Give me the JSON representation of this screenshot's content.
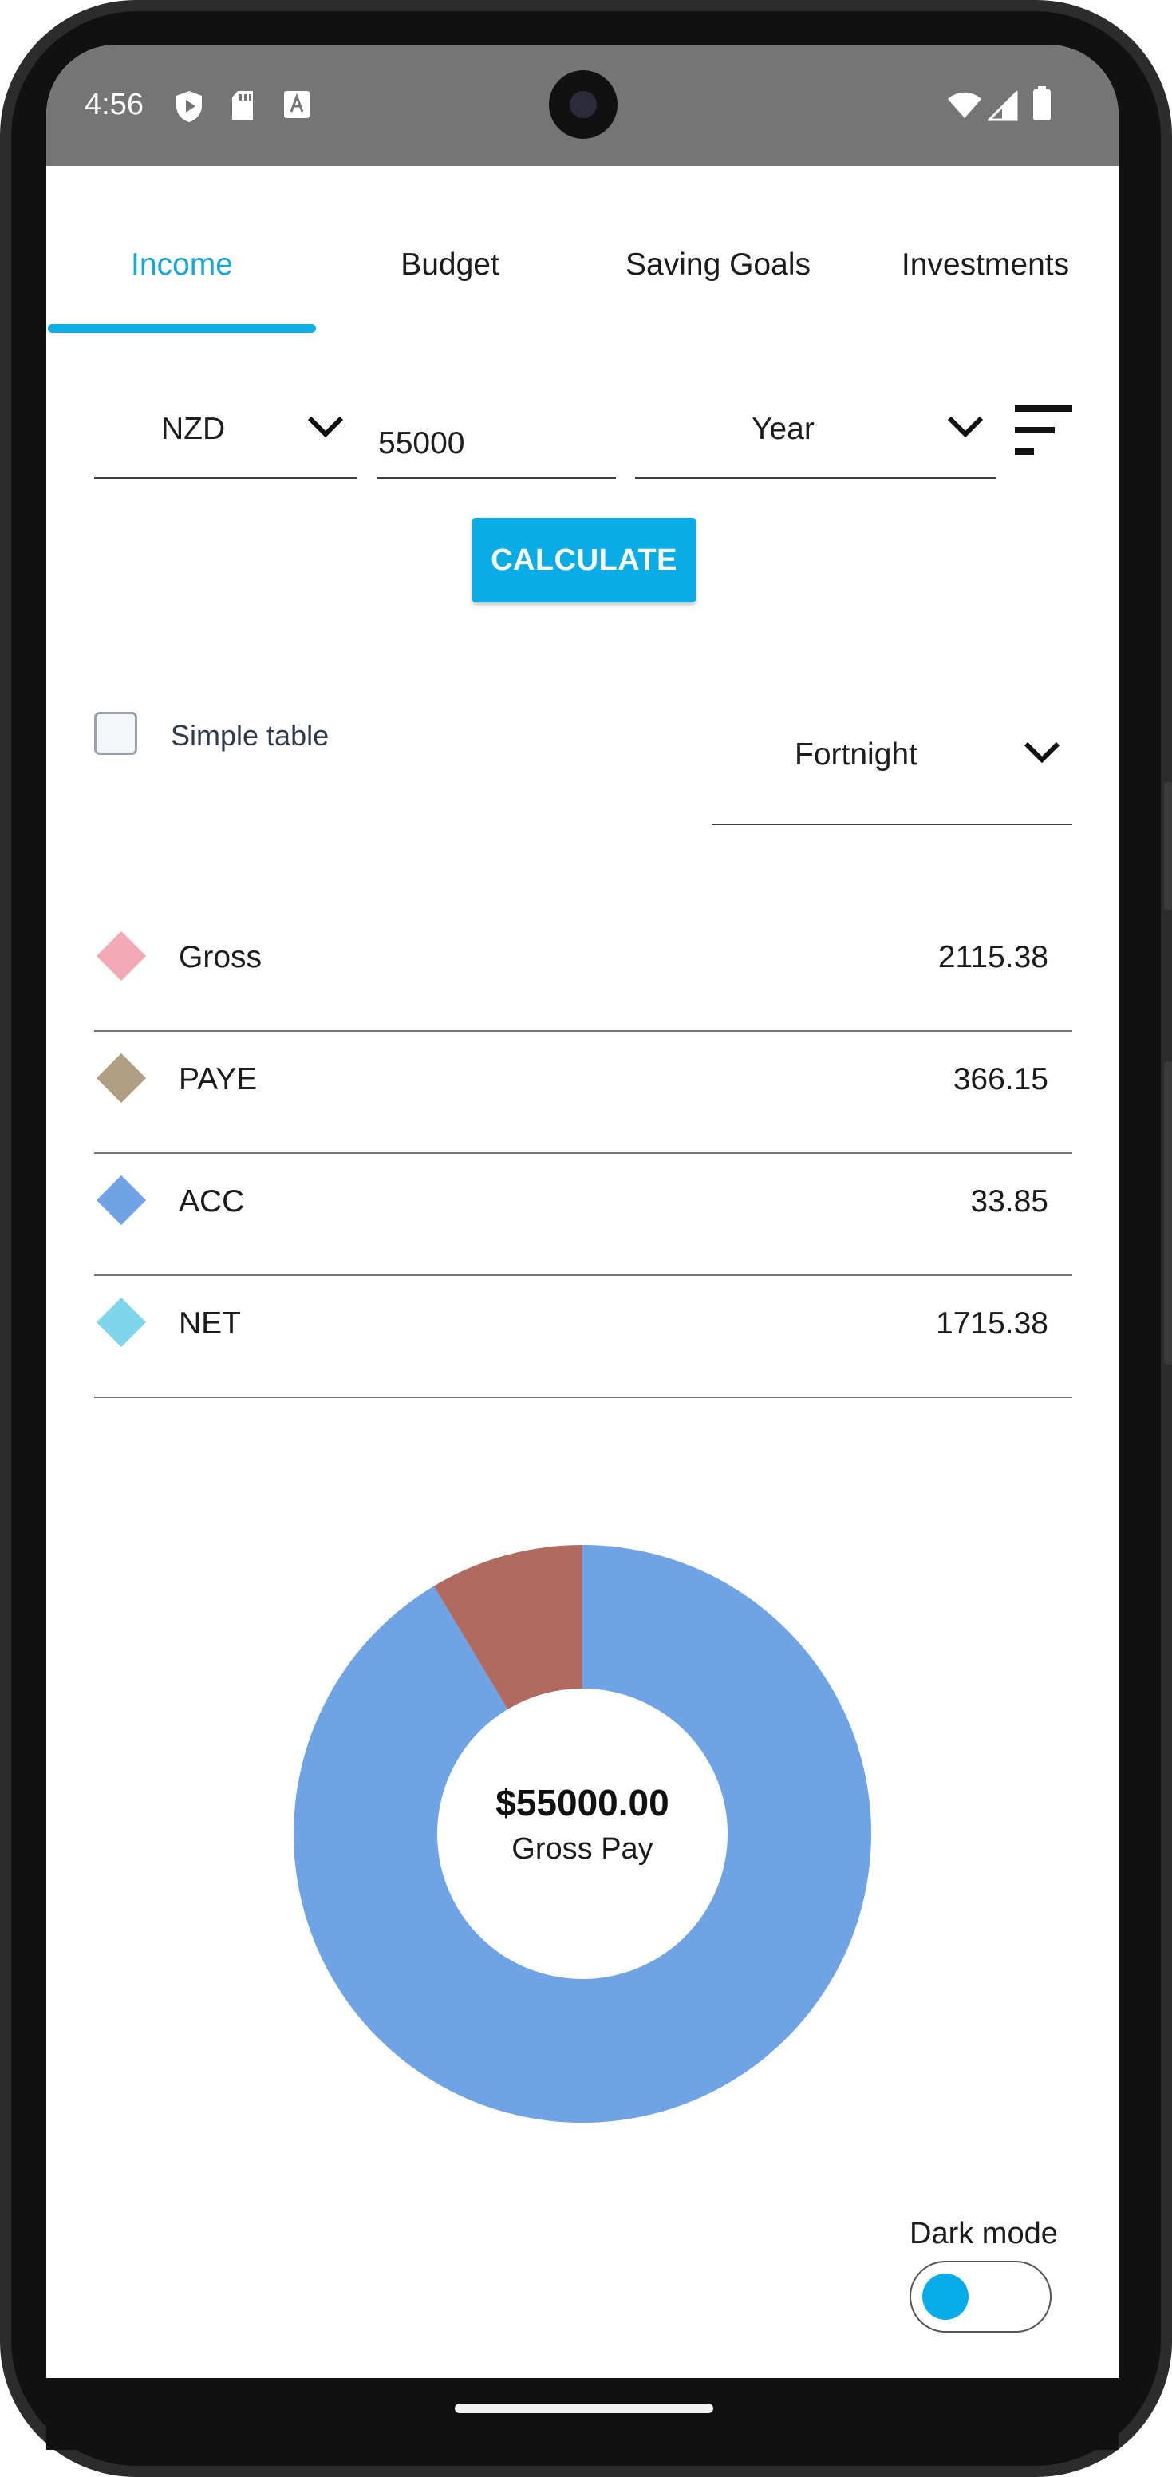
{
  "status_bar": {
    "time": "4:56",
    "icons_left": [
      "shield-play-icon",
      "sd-card-icon",
      "keyboard-a-icon"
    ],
    "icons_right": [
      "wifi-icon",
      "signal-icon",
      "battery-icon"
    ]
  },
  "tabs": [
    {
      "label": "Income",
      "active": true
    },
    {
      "label": "Budget",
      "active": false
    },
    {
      "label": "Saving Goals",
      "active": false
    },
    {
      "label": "Investments",
      "active": false
    }
  ],
  "form": {
    "currency": "NZD",
    "amount": "55000",
    "period": "Year",
    "menu_icon": "sort-lines-icon"
  },
  "calculate_label": "CALCULATE",
  "simple_table": {
    "label": "Simple table",
    "checked": false
  },
  "view_period": "Fortnight",
  "breakdown": [
    {
      "label": "Gross",
      "value": "2115.38",
      "color": "#f3a9b6"
    },
    {
      "label": "PAYE",
      "value": "366.15",
      "color": "#b09f83"
    },
    {
      "label": "ACC",
      "value": "33.85",
      "color": "#6fa3e6"
    },
    {
      "label": "NET",
      "value": "1715.38",
      "color": "#7fd5ec"
    }
  ],
  "chart_data": {
    "type": "pie",
    "donut": true,
    "center_amount": "$55000.00",
    "center_label": "Gross Pay",
    "slices": [
      {
        "value": 91.4,
        "color": "#6fa3e6"
      },
      {
        "value": 8.6,
        "color": "#b06a5f"
      }
    ]
  },
  "dark_mode": {
    "label": "Dark mode",
    "on": false
  },
  "colors": {
    "accent": "#08ace6",
    "status_bar": "#757575"
  }
}
